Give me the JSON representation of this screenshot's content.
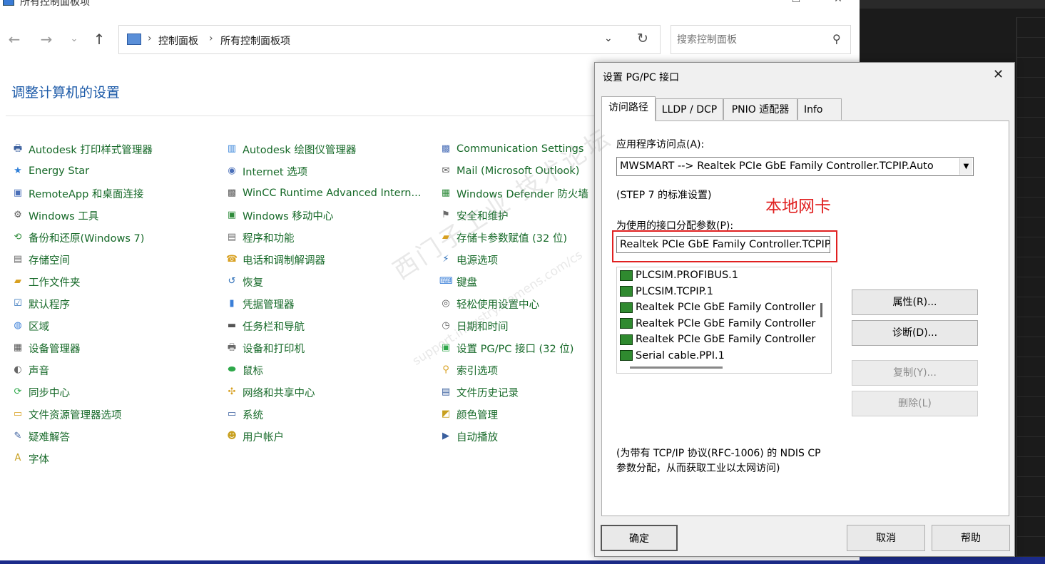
{
  "window": {
    "title": "所有控制面板项"
  },
  "address_bar": {
    "crumb_1": "控制面板",
    "crumb_2": "所有控制面板项",
    "separator": "›"
  },
  "search": {
    "placeholder": "搜索控制面板"
  },
  "page_title": "调整计算机的设置",
  "columns": [
    [
      "Autodesk 打印样式管理器",
      "Energy Star",
      "RemoteApp 和桌面连接",
      "Windows 工具",
      "备份和还原(Windows 7)",
      "存储空间",
      "工作文件夹",
      "默认程序",
      "区域",
      "设备管理器",
      "声音",
      "同步中心",
      "文件资源管理器选项",
      "疑难解答",
      "字体"
    ],
    [
      "Autodesk 绘图仪管理器",
      "Internet 选项",
      "WinCC Runtime Advanced Intern...",
      "Windows 移动中心",
      "程序和功能",
      "电话和调制解调器",
      "恢复",
      "凭据管理器",
      "任务栏和导航",
      "设备和打印机",
      "鼠标",
      "网络和共享中心",
      "系统",
      "用户帐户"
    ],
    [
      "Communication Settings",
      "Mail (Microsoft Outlook)",
      "Windows Defender 防火墙",
      "安全和维护",
      "存储卡参数赋值 (32 位)",
      "电源选项",
      "键盘",
      "轻松使用设置中心",
      "日期和时间",
      "设置 PG/PC 接口 (32 位)",
      "索引选项",
      "文件历史记录",
      "颜色管理",
      "自动播放"
    ]
  ],
  "dialog": {
    "title": "设置 PG/PC 接口",
    "tabs": [
      "访问路径",
      "LLDP / DCP",
      "PNIO 适配器",
      "Info"
    ],
    "access_point_label": "应用程序访问点(A):",
    "access_point_value": "MWSMART        --> Realtek PCIe GbE Family Controller.TCPIP.Auto",
    "standard_note": "(STEP 7 的标准设置)",
    "annotation": "本地网卡",
    "param_label": "为使用的接口分配参数(P):",
    "param_value": "Realtek PCIe GbE Family Controller.TCPIP",
    "interfaces": [
      "PLCSIM.PROFIBUS.1",
      "PLCSIM.TCPIP.1",
      "Realtek PCIe GbE Family Controller",
      "Realtek PCIe GbE Family Controller",
      "Realtek PCIe GbE Family Controller",
      "Serial cable.PPI.1"
    ],
    "buttons": {
      "properties": "属性(R)...",
      "diagnose": "诊断(D)...",
      "copy": "复制(Y)...",
      "delete": "删除(L)"
    },
    "footnote": "(为带有 TCP/IP 协议(RFC-1006) 的 NDIS CP 参数分配，从而获取工业以太网访问)",
    "ok": "确定",
    "cancel": "取消",
    "help": "帮助"
  },
  "watermark": {
    "line1": "西门子工业 技术论坛",
    "line2": "support.industry.siemens.com/cs"
  }
}
